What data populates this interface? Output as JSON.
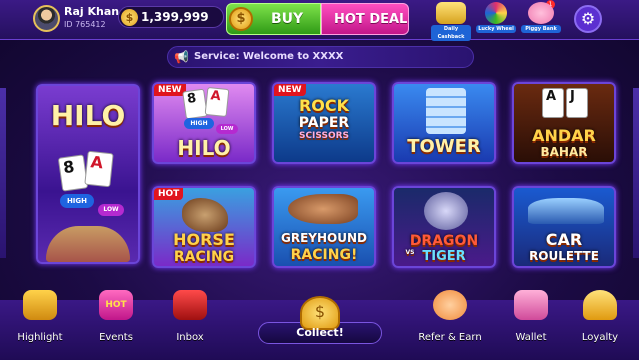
{
  "user": {
    "name": "Raj Khan",
    "id": "ID 765412"
  },
  "balance": {
    "coins": "1,399,999"
  },
  "buttons": {
    "buy": "BUY",
    "hot_deal": "HOT DEAL"
  },
  "promos": [
    {
      "label": "Daily Cashback",
      "color": "#d6a21e"
    },
    {
      "label": "Lucky Wheel",
      "color": "#e0306e",
      "badge": "1"
    },
    {
      "label": "Piggy Bank",
      "color": "#f07ab0"
    }
  ],
  "notice": {
    "text": "Service: Welcome to XXXX"
  },
  "games": {
    "hilo_featured": {
      "title": "HILO",
      "card1": "8",
      "card2": "A",
      "chip": "HIGH",
      "chip2": "LOW"
    },
    "hilo": {
      "title": "HILO",
      "tag": "NEW",
      "card1": "8",
      "card2": "A",
      "chip": "HIGH",
      "chip2": "LOW"
    },
    "rps": {
      "title_l1": "ROCK",
      "title_l2": "PAPER",
      "title_l3": "SCISSORS",
      "tag": "NEW"
    },
    "tower": {
      "title": "TOWER"
    },
    "andar": {
      "title_l1": "ANDAR",
      "title_l2": "BAHAR",
      "card1": "A",
      "card2": "J"
    },
    "horse": {
      "title_l1": "HORSE",
      "title_l2": "RACING",
      "tag": "HOT"
    },
    "greyhound": {
      "title_l1": "GREYHOUND",
      "title_l2": "RACING!"
    },
    "dragon": {
      "title_l1": "DRAGON",
      "title_vs": "VS",
      "title_l2": "TIGER"
    },
    "roulette": {
      "title_l1": "CAR",
      "title_l2": "ROULETTE"
    }
  },
  "nav": {
    "highlight": "Highlight",
    "events": "Events",
    "events_tag": "HOT",
    "inbox": "Inbox",
    "collect": "Collect!",
    "refer": "Refer & Earn",
    "wallet": "Wallet",
    "loyalty": "Loyalty"
  },
  "colors": {
    "accent": "#6b45d8",
    "buy": "#3cb820",
    "hot_deal": "#e0289e",
    "gold": "#ffd24a"
  }
}
